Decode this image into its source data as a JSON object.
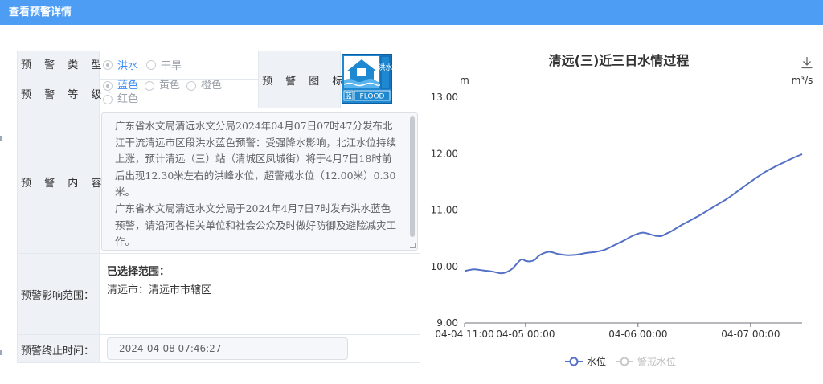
{
  "window": {
    "title": "查看预警详情"
  },
  "form": {
    "type_label": "预 警 类 型：",
    "type_options": [
      {
        "label": "洪水",
        "checked": true
      },
      {
        "label": "干旱",
        "checked": false
      }
    ],
    "level_label": "预 警 等 级：",
    "level_options": [
      {
        "label": "蓝色",
        "checked": true
      },
      {
        "label": "黄色",
        "checked": false
      },
      {
        "label": "橙色",
        "checked": false
      },
      {
        "label": "红色",
        "checked": false
      }
    ],
    "icon_label": "预 警 图 标：",
    "icon": {
      "name": "flood-warning-icon",
      "text_flood_cn": "洪水",
      "text_level_cn": "蓝",
      "text_flood_en": "FLOOD",
      "color": "#1e88d0"
    },
    "content_label": "预 警 内 容：",
    "content_text": "广东省水文局清远水文分局2024年04月07日07时47分发布北江干流清远市区段洪水蓝色预警：受强降水影响，北江水位持续上涨，预计清远（三）站（清城区凤城街）将于4月7日18时前后出现12.30米左右的洪峰水位，超警戒水位（12.00米）0.30米。\n广东省水文局清远水文分局于2024年4月7日7时发布洪水蓝色预警，请沿河各相关单位和社会公众及时做好防御及避险减灾工作。",
    "scope_label": "预警影响范围：",
    "scope_heading": "已选择范围：",
    "scope_value": "清远市：清远市市辖区",
    "end_label": "预警终止时间：",
    "end_value": "2024-04-08 07:46:27"
  },
  "chart_data": {
    "type": "line",
    "title": "清远(三)近三日水情过程",
    "ylabel": "m",
    "y2label": "m³/s",
    "ylim": [
      9.0,
      13.0
    ],
    "yticks": [
      "9.00",
      "10.00",
      "11.00",
      "12.00",
      "13.00"
    ],
    "xticks": [
      "04-04 11:00",
      "04-05 00:00",
      "04-06 00:00",
      "04-07 00:00"
    ],
    "xtick_hours": [
      0,
      13,
      37,
      61
    ],
    "x_range_hours": [
      0,
      72
    ],
    "legend": [
      "水位",
      "警戒水位"
    ],
    "legend_position": "bottom",
    "colors": {
      "water_level": "#5470c6",
      "warning_level": "#c8c8c8"
    },
    "series": [
      {
        "name": "水位",
        "x_hours": [
          0,
          2,
          4,
          6,
          8,
          10,
          12,
          13,
          14,
          15,
          16,
          18,
          20,
          22,
          24,
          26,
          28,
          30,
          32,
          34,
          36,
          38,
          40,
          41,
          42,
          43,
          44,
          46,
          48,
          50,
          52,
          54,
          56,
          58,
          60,
          62,
          64,
          66,
          68,
          70,
          72
        ],
        "values": [
          9.92,
          9.95,
          9.93,
          9.91,
          9.88,
          9.95,
          10.12,
          10.1,
          10.09,
          10.12,
          10.2,
          10.26,
          10.22,
          10.2,
          10.21,
          10.24,
          10.26,
          10.3,
          10.38,
          10.46,
          10.55,
          10.6,
          10.56,
          10.54,
          10.54,
          10.58,
          10.62,
          10.72,
          10.81,
          10.9,
          11.0,
          11.1,
          11.2,
          11.32,
          11.44,
          11.56,
          11.67,
          11.76,
          11.84,
          11.92,
          11.99
        ]
      },
      {
        "name": "警戒水位",
        "x_hours": [],
        "values": []
      }
    ]
  }
}
